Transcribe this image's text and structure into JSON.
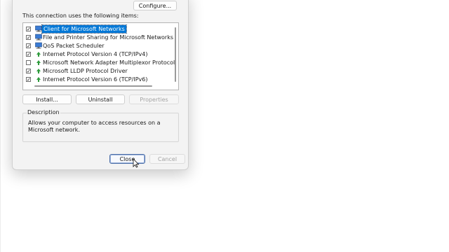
{
  "dialog": {
    "configure_label": "Configure...",
    "items_caption": "This connection uses the following items:",
    "items": [
      {
        "label": "Client for Microsoft Networks",
        "checked": true,
        "icon": "network-client-icon",
        "selected": true
      },
      {
        "label": "File and Printer Sharing for Microsoft Networks",
        "checked": true,
        "icon": "network-client-icon",
        "selected": false
      },
      {
        "label": "QoS Packet Scheduler",
        "checked": true,
        "icon": "network-client-icon",
        "selected": false
      },
      {
        "label": "Internet Protocol Version 4 (TCP/IPv4)",
        "checked": true,
        "icon": "protocol-icon",
        "selected": false
      },
      {
        "label": "Microsoft Network Adapter Multiplexor Protocol",
        "checked": false,
        "icon": "protocol-icon",
        "selected": false
      },
      {
        "label": "Microsoft LLDP Protocol Driver",
        "checked": true,
        "icon": "protocol-icon",
        "selected": false
      },
      {
        "label": "Internet Protocol Version 6 (TCP/IPv6)",
        "checked": true,
        "icon": "protocol-icon",
        "selected": false
      }
    ],
    "install_label": "Install...",
    "uninstall_label": "Uninstall",
    "properties_label": "Properties",
    "description_title": "Description",
    "description_text": "Allows your computer to access resources on a Microsoft network.",
    "close_label": "Close",
    "cancel_label": "Cancel"
  },
  "colors": {
    "selection": "#0078d7",
    "protocol_green": "#2e9b3c",
    "monitor_blue": "#3a7bd5"
  }
}
